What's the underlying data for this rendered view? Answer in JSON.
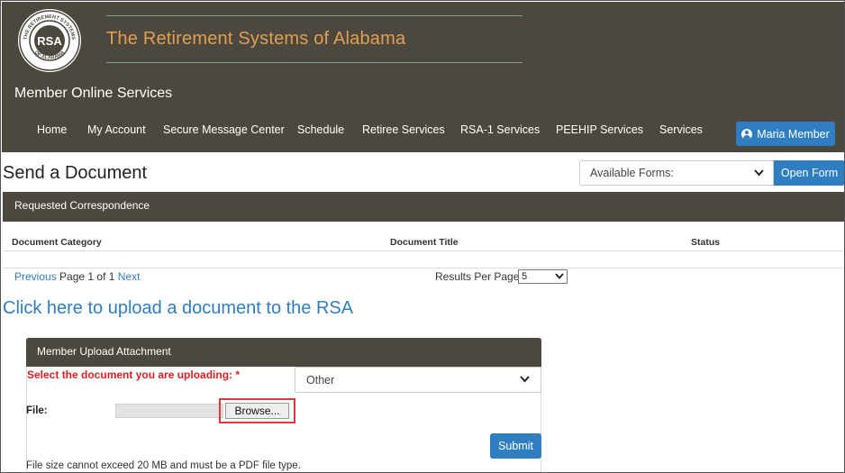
{
  "header": {
    "logo_text": "THE RETIREMENT SYSTEMS OF ALABAMA RSA",
    "site_title": "The Retirement Systems of Alabama",
    "section_title": "Member Online Services",
    "nav": [
      "Home",
      "My Account",
      "Secure Message Center",
      "Schedule",
      "Retiree Services",
      "RSA-1 Services",
      "PEEHIP Services",
      "Services"
    ],
    "user_name": "Maria Member"
  },
  "page": {
    "title": "Send a Document",
    "forms_select": "Available Forms:",
    "open_form": "Open Form"
  },
  "correspondence": {
    "panel_title": "Requested Correspondence",
    "columns": [
      "Document Category",
      "Document Title",
      "Status"
    ],
    "pager": {
      "previous": "Previous",
      "page_text": "Page 1 of 1",
      "next": "Next"
    },
    "results_per_page_label": "Results Per Page",
    "results_per_page_value": "5"
  },
  "upload": {
    "link_text": "Click here to upload a document to the RSA",
    "panel_title": "Member Upload Attachment",
    "select_label": "Select the document you are uploading: *",
    "select_value": "Other",
    "file_label": "File:",
    "browse_label": "Browse...",
    "submit_label": "Submit",
    "note": "File size cannot exceed 20 MB and must be a PDF file type."
  },
  "colors": {
    "header_bg": "#4d483f",
    "title_orange": "#e0a052",
    "accent_blue": "#2f7ec1",
    "required_red": "#e02020",
    "highlight_red": "#e03a3a"
  }
}
